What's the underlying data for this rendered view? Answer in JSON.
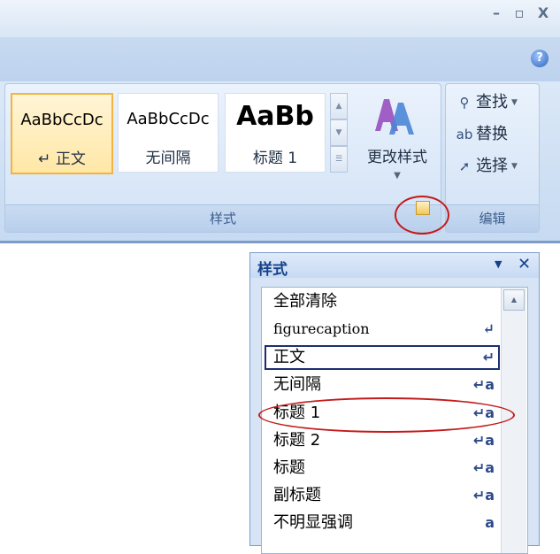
{
  "window": {
    "minimize_glyph": "–",
    "restore_glyph": "▫",
    "close_glyph": "X"
  },
  "help_glyph": "?",
  "ribbon": {
    "styles_group_label": "样式",
    "edit_group_label": "编辑",
    "gallery": [
      {
        "sample": "AaBbCcDc",
        "name": "↵ 正文",
        "selected": true
      },
      {
        "sample": "AaBbCcDc",
        "name": "无间隔",
        "selected": false
      },
      {
        "sample": "AaBb",
        "name": "标题 1",
        "selected": false
      }
    ],
    "change_styles_label": "更改样式",
    "edit_items": [
      {
        "icon": "find-icon",
        "glyph": "⚲",
        "label": "查找",
        "dropdown": true
      },
      {
        "icon": "replace-icon",
        "glyph": "ab",
        "label": "替换",
        "dropdown": false
      },
      {
        "icon": "select-icon",
        "glyph": "➚",
        "label": "选择",
        "dropdown": true
      }
    ]
  },
  "styles_pane": {
    "title": "样式",
    "close_glyph": "✕",
    "items": [
      {
        "label": "全部清除",
        "mark": ""
      },
      {
        "label": "figurecaption",
        "mark": "↵"
      },
      {
        "label": "正文",
        "mark": "↵"
      },
      {
        "label": "无间隔",
        "mark": "↵a"
      },
      {
        "label": "标题 1",
        "mark": "↵a"
      },
      {
        "label": "标题 2",
        "mark": "↵a"
      },
      {
        "label": "标题",
        "mark": "↵a"
      },
      {
        "label": "副标题",
        "mark": "↵a"
      },
      {
        "label": "不明显强调",
        "mark": "a"
      }
    ]
  },
  "colors": {
    "annotation": "#c41a1a",
    "selected_tile": "#f3b340",
    "pane_title": "#15428b"
  }
}
